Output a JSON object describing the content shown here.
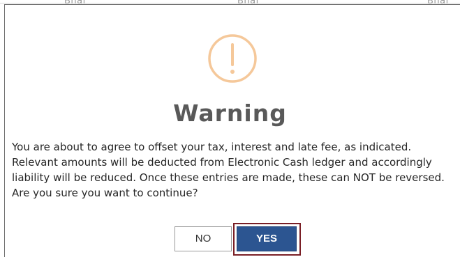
{
  "background": {
    "fragments": [
      "Bhai",
      "Bhai",
      "Bhai"
    ]
  },
  "dialog": {
    "icon": "exclamation-circle-icon",
    "title": "Warning",
    "message": "You are about to agree to offset your tax, interest and late fee, as indicated. Relevant amounts will be deducted from Electronic Cash ledger and accordingly liability will be reduced. Once these entries are made, these can NOT be reversed. Are you sure you want to continue?",
    "buttons": {
      "no_label": "NO",
      "yes_label": "YES"
    }
  },
  "colors": {
    "icon": "#f5c89a",
    "yes_button": "#2c5591",
    "highlight_outline": "#7a1f26"
  }
}
